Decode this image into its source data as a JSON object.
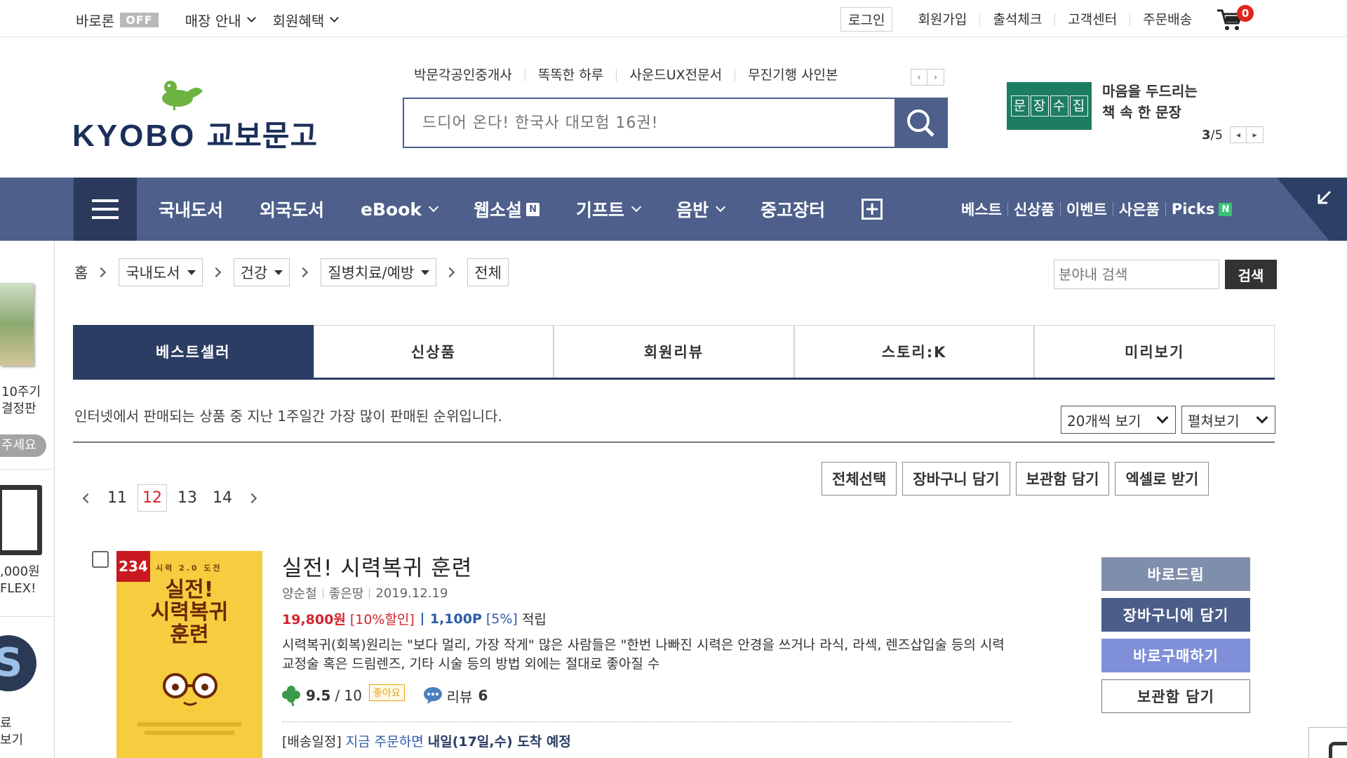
{
  "topbar": {
    "baron_label": "바로론",
    "baron_state": "OFF",
    "store_guide": "매장 안내",
    "member_benefit": "회원혜택",
    "login": "로그인",
    "signup": "회원가입",
    "attendance": "출석체크",
    "customer_center": "고객센터",
    "order_delivery": "주문배송",
    "cart_count": "0"
  },
  "header": {
    "logo_en": "KYOBO",
    "logo_kr": "교보문고",
    "keywords": [
      "박문각공인중개사",
      "똑똑한 하루",
      "사운드UX전문서",
      "무진기행 사인본"
    ],
    "search_placeholder": "드디어 온다! 한국사 대모험 16권!",
    "banner_image_text": [
      "문",
      "장",
      "수",
      "집"
    ],
    "banner_line1": "마음을 두드리는",
    "banner_line2": "책 속 한 문장",
    "banner_page_current": "3",
    "banner_page_total": "/5"
  },
  "gnb": {
    "items": [
      {
        "label": "국내도서"
      },
      {
        "label": "외국도서"
      },
      {
        "label": "eBook"
      },
      {
        "label": "웹소설"
      },
      {
        "label": "기프트"
      },
      {
        "label": "음반"
      },
      {
        "label": "중고장터"
      }
    ],
    "n_badge": "N",
    "right": [
      "베스트",
      "신상품",
      "이벤트",
      "사은품",
      "Picks"
    ]
  },
  "side": {
    "text1a": "10주기",
    "text1b": "결정판",
    "pill": "주세요",
    "text2a": ",000원",
    "text2b": "FLEX!",
    "circle": "S",
    "text3a": "료",
    "text3b": "보기"
  },
  "breadcrumb": {
    "home": "홈",
    "level1": "국내도서",
    "level2": "건강",
    "level3": "질병치료/예방",
    "level4": "전체",
    "search_placeholder": "분야내 검색",
    "search_button": "검색"
  },
  "tabs": [
    "베스트셀러",
    "신상품",
    "회원리뷰",
    "스토리:K",
    "미리보기"
  ],
  "list": {
    "description": "인터넷에서 판매되는 상품 중 지난 1주일간 가장 많이 판매된 순위입니다.",
    "per_page": "20개씩 보기",
    "view_mode": "펼쳐보기",
    "pages": [
      "11",
      "12",
      "13",
      "14"
    ],
    "current_page": "12",
    "actions": [
      "전체선택",
      "장바구니 담기",
      "보관함 담기",
      "엑셀로 받기"
    ]
  },
  "product": {
    "rank": "234",
    "cover_sub": "시력 2.0 도전",
    "cover_title_1": "실전!",
    "cover_title_2": "시력복귀",
    "cover_title_3": "훈련",
    "title": "실전! 시력복귀 훈련",
    "author": "양순철",
    "publisher": "좋은땅",
    "date": "2019.12.19",
    "price": "19,800원",
    "discount": "[10%할인]",
    "points": "1,100P",
    "points_rate": "[5%]",
    "points_label": "적립",
    "summary": "시력복귀(회복)원리는 \"보다 멀리, 가장 작게\" 많은 사람들은 \"한번 나빠진 시력은 안경을 쓰거나 라식, 라섹, 렌즈삽입술 등의 시력교정술 혹은 드림렌즈, 기타 시술 등의 방법 외에는 절대로 좋아질 수",
    "score": "9.5",
    "score_max": "/ 10",
    "good_badge": "좋아요",
    "review_label": "리뷰",
    "review_count": "6",
    "ship_label": "[배송일정]",
    "ship_text": "지금 주문하면",
    "ship_date": "내일(17일,수) 도착 예정",
    "buttons": [
      "바로드림",
      "장바구니에 담기",
      "바로구매하기",
      "보관함 담기"
    ]
  },
  "colors": {
    "navy": "#4d5f8a",
    "navy_dark": "#2c3d63",
    "price_red": "#d2232a",
    "point_blue": "#2c5caa"
  }
}
